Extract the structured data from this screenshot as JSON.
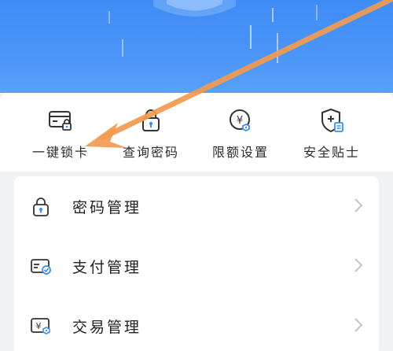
{
  "quick_actions": [
    {
      "label": "一键锁卡",
      "icon": "card-lock-icon"
    },
    {
      "label": "查询密码",
      "icon": "padlock-icon"
    },
    {
      "label": "限额设置",
      "icon": "yuan-limit-icon"
    },
    {
      "label": "安全贴士",
      "icon": "shield-tips-icon"
    }
  ],
  "menu": [
    {
      "label": "密码管理",
      "icon": "lock-icon"
    },
    {
      "label": "支付管理",
      "icon": "card-pay-icon"
    },
    {
      "label": "交易管理",
      "icon": "yuan-card-icon"
    }
  ],
  "colors": {
    "brand_blue": "#3f8cf5",
    "annotation_arrow": "#f39a4f",
    "icon_accent": "#3d8df3"
  }
}
